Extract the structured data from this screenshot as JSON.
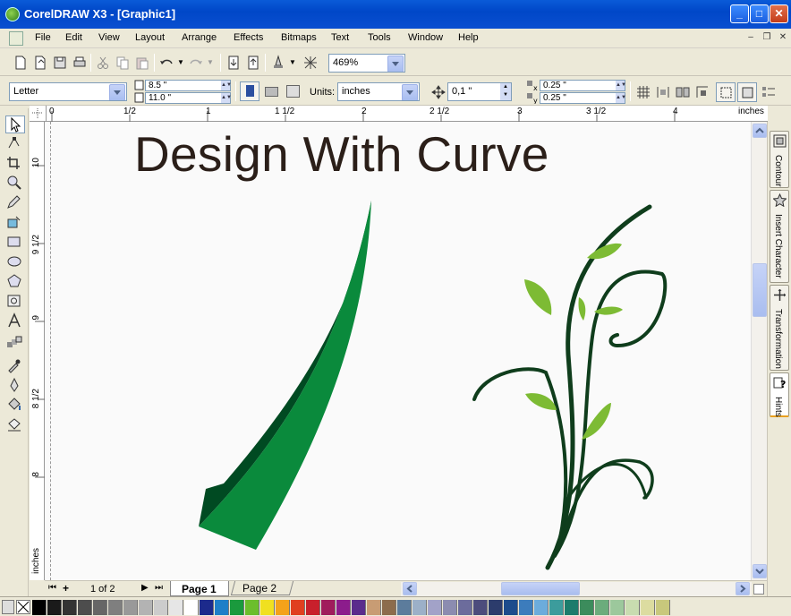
{
  "window": {
    "title": "CorelDRAW X3 - [Graphic1]"
  },
  "menu": [
    "File",
    "Edit",
    "View",
    "Layout",
    "Arrange",
    "Effects",
    "Bitmaps",
    "Text",
    "Tools",
    "Window",
    "Help"
  ],
  "standard_toolbar": {
    "zoom": "469%"
  },
  "property_bar": {
    "paper_type": "Letter",
    "width": "8.5 \"",
    "height": "11.0 \"",
    "units_label": "Units:",
    "units_value": "inches",
    "nudge": "0,1 \"",
    "dup_x": "0.25 \"",
    "dup_y": "0.25 \""
  },
  "rulers": {
    "h_labels": [
      "0",
      "1/2",
      "1",
      "1 1/2",
      "2",
      "2 1/2",
      "3",
      "3 1/2",
      "4",
      "inches"
    ],
    "v_labels": [
      "10",
      "9 1/2",
      "9",
      "8 1/2",
      "8",
      "inches"
    ]
  },
  "canvas": {
    "heading": "Design With Curve"
  },
  "docker_tabs": [
    "Contour",
    "Insert Character",
    "Transformation",
    "Hints"
  ],
  "pages": {
    "counter": "1 of 2",
    "tabs": [
      "Page 1",
      "Page 2"
    ],
    "active": "Page 1"
  },
  "colors": {
    "leaf_light": "#0a8a3c",
    "leaf_dark": "#004a22",
    "stem": "#0f3d1c",
    "leaf_lime": "#7dbb34",
    "heading": "#2b1f19"
  },
  "palette": [
    "#000000",
    "#1a1a1a",
    "#333333",
    "#4d4d4d",
    "#666666",
    "#7f7f7f",
    "#999999",
    "#b3b3b3",
    "#cccccc",
    "#e6e6e6",
    "#ffffff",
    "#1c2a8c",
    "#1e7fc8",
    "#1a9a3d",
    "#6cbe2c",
    "#f0e020",
    "#f4a21a",
    "#e04020",
    "#c8202c",
    "#a01c5c",
    "#8c1c8c",
    "#5a2c8c",
    "#c89c74",
    "#8c6c4c",
    "#5c7c9c",
    "#9cb0c8",
    "#a2a2c8",
    "#8c8cb0",
    "#6c6c9c",
    "#4c4c7c",
    "#2c3c6c",
    "#1c4c8c",
    "#3c7cbc",
    "#6cacdc",
    "#3c9c9c",
    "#1c7c6c",
    "#3c8c5c",
    "#6cac7c",
    "#9cc89c",
    "#c8dcb0",
    "#dcdca0",
    "#c8c87c"
  ]
}
